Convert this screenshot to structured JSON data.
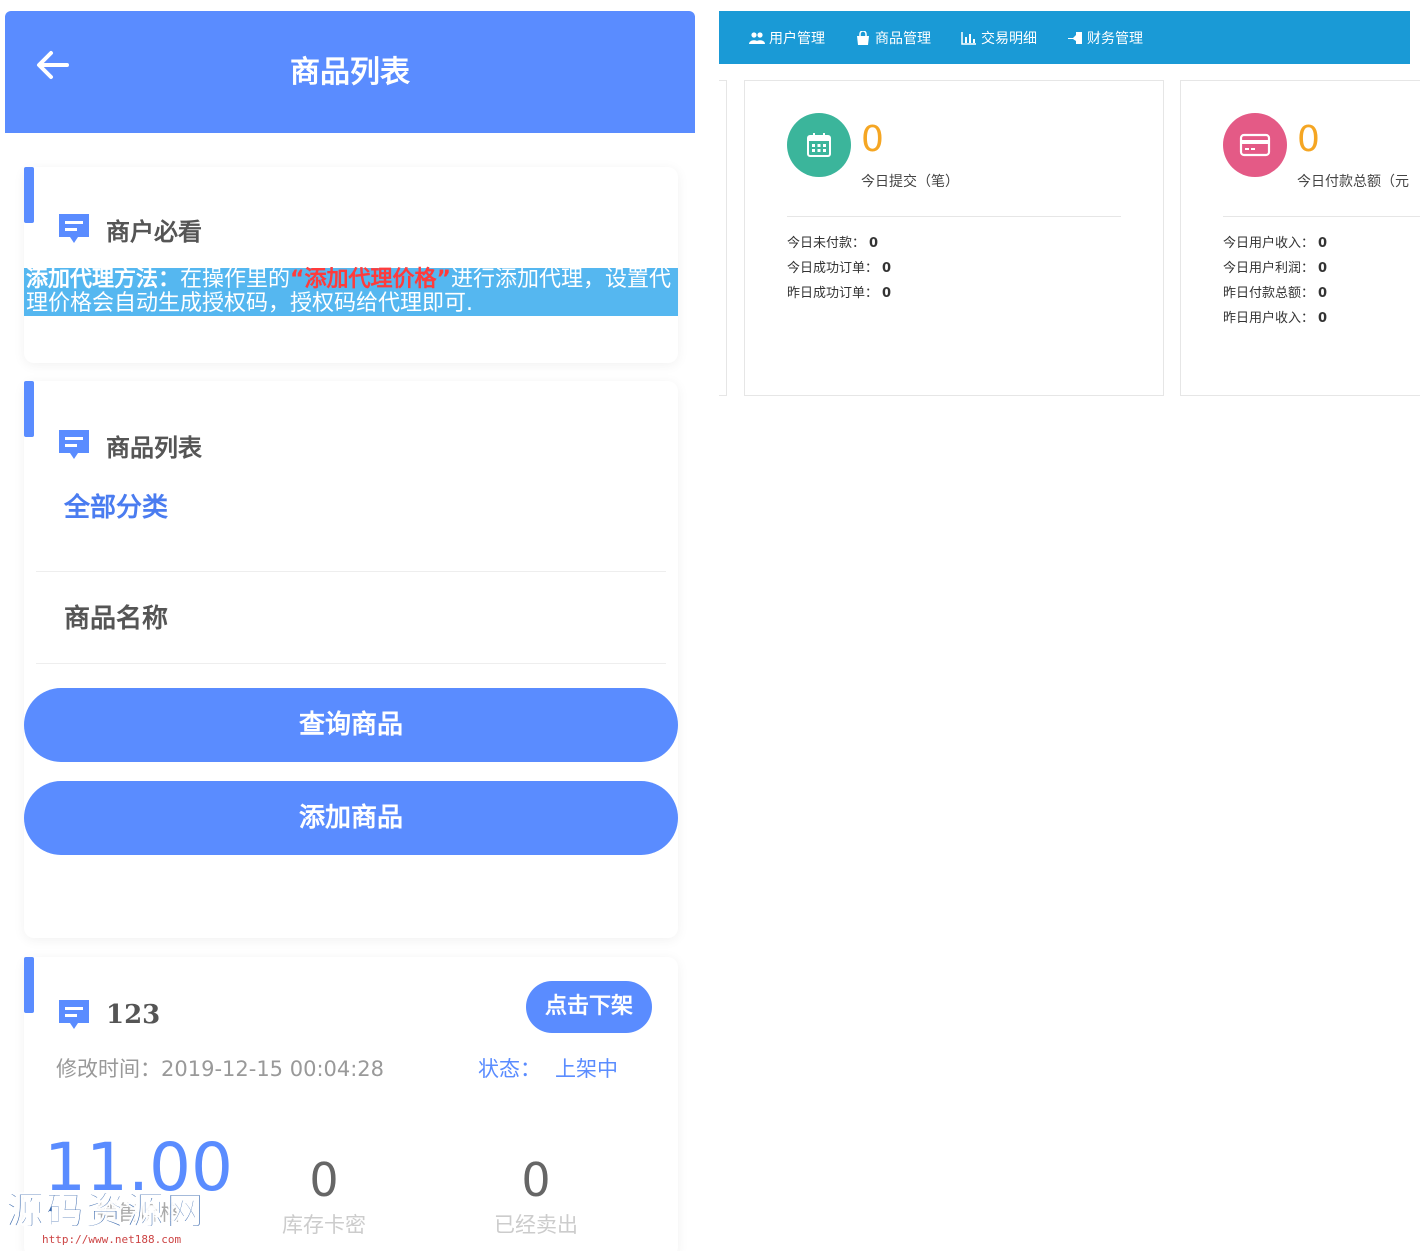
{
  "mobile": {
    "header": {
      "title": "商品列表"
    },
    "notice_card": {
      "title": "商户必看",
      "text_prefix": "添加代理方法：",
      "text_mid1": "在操作里的",
      "text_highlight": "“添加代理价格”",
      "text_rest": "进行添加代理，设置代理价格会自动生成授权码，授权码给代理即可."
    },
    "list_card": {
      "title": "商品列表",
      "category": "全部分类",
      "name_placeholder": "商品名称",
      "query_button": "查询商品",
      "add_button": "添加商品"
    },
    "product": {
      "name": "123",
      "off_button": "点击下架",
      "modified_label": "修改时间：",
      "modified_value": "2019-12-15 00:04:28",
      "status_label": "状态：",
      "status_value": "上架中",
      "price_value": "11.00",
      "price_label": "销售价格",
      "stock_value": "0",
      "stock_label": "库存卡密",
      "sold_value": "0",
      "sold_label": "已经卖出"
    },
    "watermark": {
      "main": "源码资源网",
      "url": "http://www.net188.com"
    }
  },
  "dashboard": {
    "nav": [
      {
        "label": "用户管理",
        "icon": "users-icon"
      },
      {
        "label": "商品管理",
        "icon": "bag-icon"
      },
      {
        "label": "交易明细",
        "icon": "bar-chart-icon"
      },
      {
        "label": "财务管理",
        "icon": "hand-icon"
      }
    ],
    "panel1": {
      "value": "0",
      "label": "今日提交（笔）",
      "rows": [
        {
          "label": "今日未付款：",
          "value": "0"
        },
        {
          "label": "今日成功订单：",
          "value": "0"
        },
        {
          "label": "昨日成功订单：",
          "value": "0"
        }
      ]
    },
    "panel2": {
      "value": "0",
      "label": "今日付款总额（元",
      "rows": [
        {
          "label": "今日用户收入：",
          "value": "0"
        },
        {
          "label": "今日用户利润：",
          "value": "0"
        },
        {
          "label": "昨日付款总额：",
          "value": "0"
        },
        {
          "label": "昨日用户收入：",
          "value": "0"
        }
      ]
    },
    "colors": {
      "nav_bg": "#1a9ad6",
      "green": "#3bb59b",
      "pink": "#e45a86",
      "orange": "#f5a623",
      "primary": "#5a8cff"
    }
  }
}
